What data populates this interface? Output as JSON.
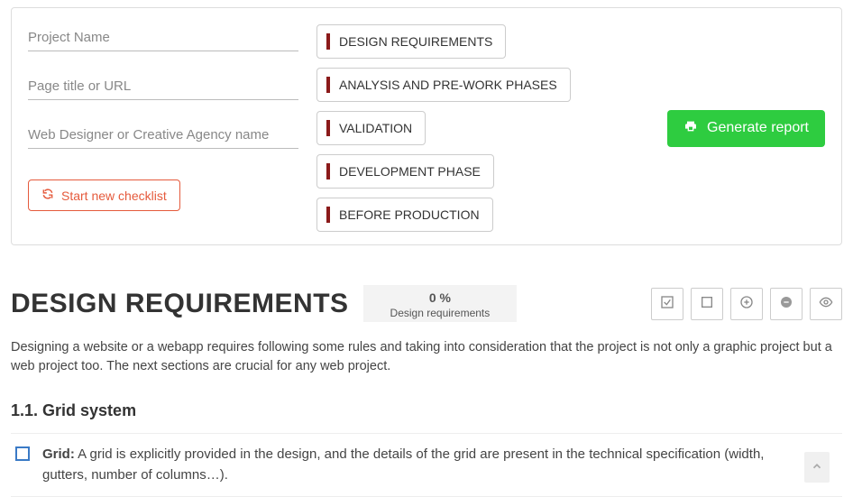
{
  "inputs": {
    "project_name_placeholder": "Project Name",
    "page_title_placeholder": "Page title or URL",
    "designer_placeholder": "Web Designer or Creative Agency name"
  },
  "buttons": {
    "start_new": "Start new checklist",
    "generate": "Generate report"
  },
  "nav": {
    "items": [
      "DESIGN REQUIREMENTS",
      "ANALYSIS AND PRE-WORK PHASES",
      "VALIDATION",
      "DEVELOPMENT PHASE",
      "BEFORE PRODUCTION"
    ]
  },
  "section": {
    "title": "DESIGN REQUIREMENTS",
    "progress_pct": "0 %",
    "progress_label": "Design requirements",
    "description": "Designing a website or a webapp requires following some rules and taking into consideration that the project is not only a graphic project but a web project too. The next sections are crucial for any web project."
  },
  "subsection": {
    "title": "1.1.  Grid system",
    "item_label": "Grid:",
    "item_text": " A grid is explicitly provided in the design, and the details of the grid are present in the technical specification (width, gutters, number of columns…)."
  }
}
